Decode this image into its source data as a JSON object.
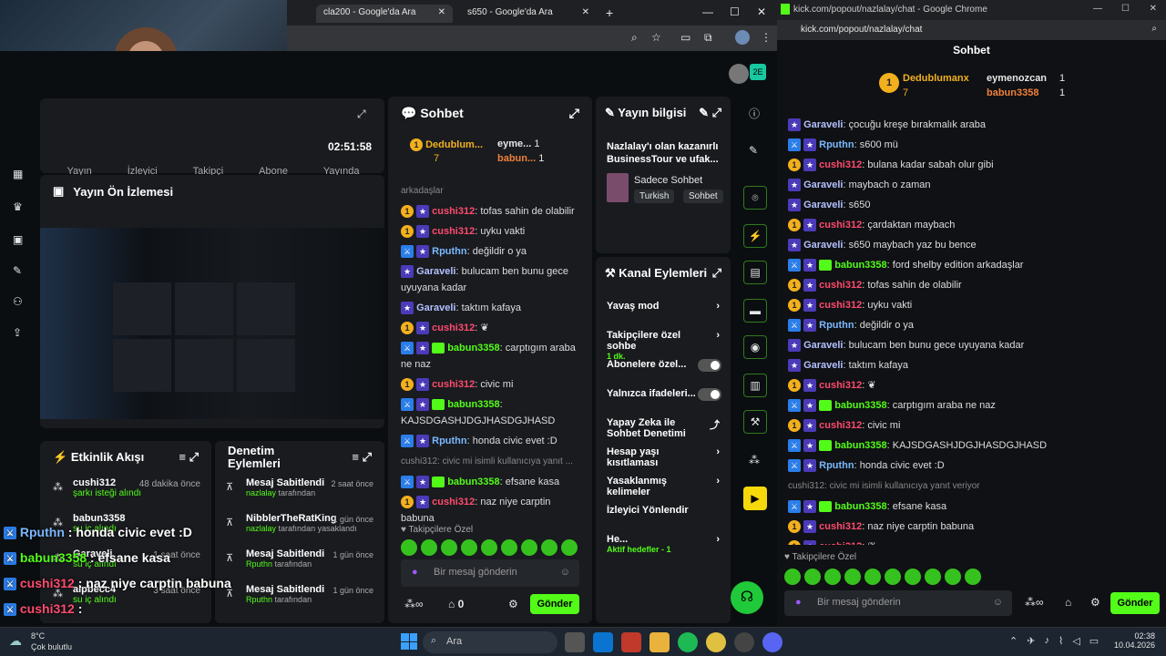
{
  "browser_left": {
    "tabs": [
      {
        "label": "cla200 - Google'da Ara"
      },
      {
        "label": "s650 - Google'da Ara"
      }
    ]
  },
  "browser_right": {
    "title": "kick.com/popout/nazlalay/chat - Google Chrome",
    "url": "kick.com/popout/nazlalay/chat"
  },
  "dashboard": {
    "top_stats": {
      "labels": [
        "Yayın",
        "İzleyici",
        "Takipçi",
        "Abone"
      ],
      "time": "02:51:58",
      "time_label": "Yayında"
    },
    "preview_title": "Yayın Ön İzlemesi",
    "activity": {
      "title": "Etkinlik Akışı",
      "items": [
        {
          "name": "cushi312",
          "detail": "şarkı isteği alındı",
          "time": "48 dakika önce"
        },
        {
          "name": "babun3358",
          "detail": "su iç alındı",
          "time": ""
        },
        {
          "name": "Garaveli",
          "detail": "su iç alındı",
          "time": "1 saat önce"
        },
        {
          "name": "alpbecc4",
          "detail": "su iç alındı",
          "time": "3 saat önce"
        }
      ]
    },
    "mod": {
      "title": "Denetim Eylemleri",
      "items": [
        {
          "title": "Mesaj Sabitlendi",
          "by": "nazlalay",
          "suffix": "tarafından",
          "time": "2 saat önce"
        },
        {
          "title": "NibblerTheRatKing",
          "by": "nazlalay",
          "suffix": "tarafından yasaklandı",
          "time": "1 gün önce"
        },
        {
          "title": "Mesaj Sabitlendi",
          "by": "Rputhn",
          "suffix": "tarafından",
          "time": "1 gün önce"
        },
        {
          "title": "Mesaj Sabitlendi",
          "by": "Rputhn",
          "suffix": "tarafından",
          "time": "1 gün önce"
        }
      ]
    },
    "chat": {
      "title": "Sohbet",
      "top": [
        {
          "name": "Dedublum...",
          "count": "7"
        },
        {
          "name": "eyme...",
          "count": "1"
        },
        {
          "name": "babun...",
          "count": "1"
        }
      ],
      "messages": [
        {
          "user": "",
          "cls": "",
          "text": "arkadaşlar"
        },
        {
          "user": "cushi312",
          "cls": "u-red",
          "text": "tofas sahin de olabilir"
        },
        {
          "user": "cushi312",
          "cls": "u-red",
          "text": "uyku vakti"
        },
        {
          "user": "Rputhn",
          "cls": "u-blue",
          "text": "değildir o ya"
        },
        {
          "user": "Garaveli",
          "cls": "u-gray",
          "text": "bulucam ben bunu gece uyuyana kadar"
        },
        {
          "user": "Garaveli",
          "cls": "u-gray",
          "text": "taktım kafaya"
        },
        {
          "user": "cushi312",
          "cls": "u-red",
          "text": ""
        },
        {
          "user": "babun3358",
          "cls": "u-green",
          "text": "carptıgım araba ne naz"
        },
        {
          "user": "cushi312",
          "cls": "u-red",
          "text": "civic mi"
        },
        {
          "user": "babun3358",
          "cls": "u-green",
          "text": "KAJSDGASHJDGJHASDGJHASD"
        },
        {
          "user": "Rputhn",
          "cls": "u-blue",
          "text": "honda civic evet :D"
        },
        {
          "user": "",
          "cls": "",
          "text": "cushi312: civic mi isimli kullanıcıya yanıt ..."
        },
        {
          "user": "babun3358",
          "cls": "u-green",
          "text": "efsane kasa"
        },
        {
          "user": "cushi312",
          "cls": "u-red",
          "text": "naz niye carptin babuna"
        },
        {
          "user": "cushi312",
          "cls": "u-red",
          "text": ""
        }
      ],
      "followers_label": "Takipçilere Özel",
      "input_placeholder": "Bir mesaj gönderin",
      "count": "0",
      "send": "Gönder"
    },
    "stream_info": {
      "title": "Yayın bilgisi",
      "desc": "Nazlalay'ı olan kazanırlı BusinessTour ve ufak...",
      "category": "Sadece Sohbet",
      "tags": [
        "Turkish",
        "Sohbet"
      ]
    },
    "channel_actions": {
      "title": "Kanal Eylemleri",
      "items": [
        {
          "label": "Yavaş mod",
          "type": "arrow",
          "sub": ""
        },
        {
          "label": "Takipçilere özel sohbe",
          "type": "arrow",
          "sub": "1 dk."
        },
        {
          "label": "Abonelere özel...",
          "type": "toggle",
          "sub": ""
        },
        {
          "label": "Yalnızca ifadeleri...",
          "type": "toggle",
          "sub": ""
        },
        {
          "label": "Yapay Zeka ile Sohbet Denetimi",
          "type": "ext",
          "sub": ""
        },
        {
          "label": "Hesap yaşı kısıtlaması",
          "type": "arrow",
          "sub": ""
        },
        {
          "label": "Yasaklanmış kelimeler",
          "type": "arrow",
          "sub": ""
        },
        {
          "label": "İzleyici Yönlendir",
          "type": "none",
          "sub": ""
        },
        {
          "label": "He...",
          "type": "arrow",
          "sub": "Aktif hedefler - 1"
        }
      ]
    }
  },
  "popout": {
    "title": "Sohbet",
    "top": [
      {
        "name": "Dedublumanx",
        "count": "7"
      },
      {
        "name": "eymenozcan",
        "count": "1"
      },
      {
        "name": "babun3358",
        "count": "1"
      }
    ],
    "messages": [
      {
        "user": "Garaveli",
        "cls": "u-gray",
        "text": "çocuğu kreşe bırakmalık araba"
      },
      {
        "user": "Rputhn",
        "cls": "u-blue",
        "text": "s600 mü"
      },
      {
        "user": "cushi312",
        "cls": "u-red",
        "text": "bulana kadar sabah olur gibi"
      },
      {
        "user": "Garaveli",
        "cls": "u-gray",
        "text": "maybach o zaman"
      },
      {
        "user": "Garaveli",
        "cls": "u-gray",
        "text": "s650"
      },
      {
        "user": "cushi312",
        "cls": "u-red",
        "text": "çardaktan maybach"
      },
      {
        "user": "Garaveli",
        "cls": "u-gray",
        "text": "s650 maybach yaz bu bence"
      },
      {
        "user": "babun3358",
        "cls": "u-green",
        "text": "ford shelby edition arkadaşlar"
      },
      {
        "user": "cushi312",
        "cls": "u-red",
        "text": "tofas sahin de olabilir"
      },
      {
        "user": "cushi312",
        "cls": "u-red",
        "text": "uyku vakti"
      },
      {
        "user": "Rputhn",
        "cls": "u-blue",
        "text": "değildir o ya"
      },
      {
        "user": "Garaveli",
        "cls": "u-gray",
        "text": "bulucam ben bunu gece uyuyana kadar"
      },
      {
        "user": "Garaveli",
        "cls": "u-gray",
        "text": "taktım kafaya"
      },
      {
        "user": "cushi312",
        "cls": "u-red",
        "text": ""
      },
      {
        "user": "babun3358",
        "cls": "u-green",
        "text": "carptıgım araba ne naz"
      },
      {
        "user": "cushi312",
        "cls": "u-red",
        "text": "civic mi"
      },
      {
        "user": "babun3358",
        "cls": "u-green",
        "text": "KAJSDGASHJDGJHASDGJHASD"
      },
      {
        "user": "Rputhn",
        "cls": "u-blue",
        "text": "honda civic evet :D"
      },
      {
        "user": "",
        "cls": "",
        "text": "cushi312: civic mi isimli kullanıcıya yanıt veriyor"
      },
      {
        "user": "babun3358",
        "cls": "u-green",
        "text": "efsane kasa"
      },
      {
        "user": "cushi312",
        "cls": "u-red",
        "text": "naz niye carptin babuna"
      },
      {
        "user": "cushi312",
        "cls": "u-red",
        "text": ""
      }
    ],
    "followers_label": "Takipçilere Özel",
    "input_placeholder": "Bir mesaj gönderin",
    "send": "Gönder"
  },
  "overlay": {
    "lines": [
      {
        "user": "Rputhn",
        "text": " : honda civic evet :D"
      },
      {
        "user": "babun3358",
        "text": " : efsane kasa"
      },
      {
        "user": "cushi312",
        "text": " : naz niye carptin babuna"
      },
      {
        "user": "cushi312",
        "text": " :"
      }
    ]
  },
  "taskbar": {
    "weather_temp": "8°C",
    "weather_desc": "Çok bulutlu",
    "search": "Ara",
    "time": "02:38",
    "date": "10.04.2026"
  }
}
